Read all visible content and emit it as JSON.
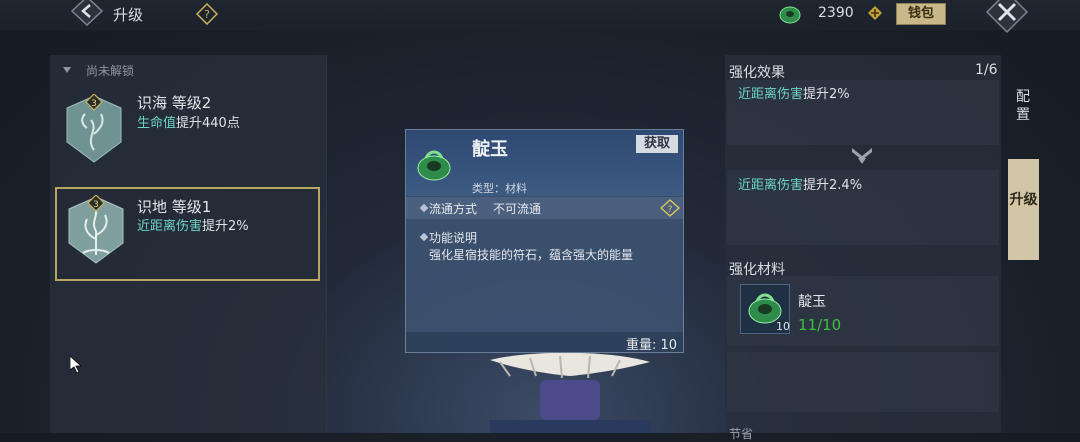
{
  "header": {
    "title": "升级",
    "currency_value": "2390",
    "wallet_label": "钱包"
  },
  "left": {
    "section_label": "尚未解锁",
    "skills": [
      {
        "badge": "3",
        "name": "识海 等级2",
        "desc_highlight": "生命值",
        "desc_rest": "提升440点"
      },
      {
        "badge": "3",
        "name": "识地 等级1",
        "desc_highlight": "近距离伤害",
        "desc_rest": "提升2%"
      }
    ]
  },
  "tooltip": {
    "item_name": "靛玉",
    "get_label": "获取",
    "type_text": "类型：材料",
    "circulation_label": "流通方式",
    "circulation_value": "不可流通",
    "function_label": "功能说明",
    "function_desc": "强化星宿技能的符石，蕴含强大的能量",
    "weight_text": "重量: 10"
  },
  "right": {
    "effect_title": "强化效果",
    "effect_count": "1/6",
    "effect_current_highlight": "近距离伤害",
    "effect_current_rest": "提升2%",
    "effect_next_highlight": "近距离伤害",
    "effect_next_rest": "提升2.4%",
    "material_title": "强化材料",
    "material_name": "靛玉",
    "material_icon_count": "10",
    "material_qty": "11/10",
    "cut_text": "节省"
  },
  "side_tabs": {
    "config_label": "配置",
    "upgrade_label": "升级"
  },
  "colors": {
    "highlight": "#6ed3c4",
    "qty_ok": "#3fbf3f",
    "selected_border": "#b5a661"
  }
}
